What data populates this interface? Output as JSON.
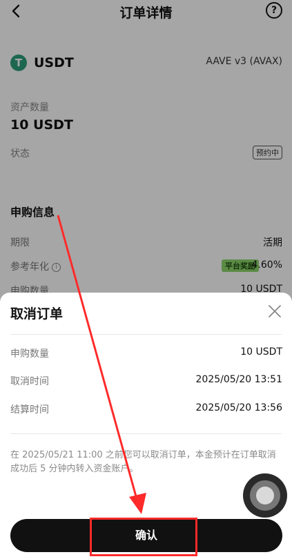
{
  "header": {
    "title": "订单详情",
    "back_icon": "chevron-left-icon",
    "help_icon": "help-circle-icon",
    "help_glyph": "?"
  },
  "asset": {
    "icon": "tether-icon",
    "icon_glyph": "T",
    "name": "USDT",
    "protocol": "AAVE v3 (AVAX)"
  },
  "summary": {
    "amount_label": "资产数量",
    "amount_value": "10 USDT",
    "status_label": "状态",
    "status_badge": "预约中"
  },
  "subscription": {
    "title": "申购信息",
    "term_label": "期限",
    "term_value": "活期",
    "apr_label": "参考年化",
    "reward_badge": "平台奖励",
    "apr_value": "4.60%",
    "subscribed_label": "申购数量",
    "subscribed_value": "10 USDT"
  },
  "sheet": {
    "title": "取消订单",
    "close_icon": "close-icon",
    "rows": [
      {
        "label": "申购数量",
        "value": "10 USDT"
      },
      {
        "label": "取消时间",
        "value": "2025/05/20 13:51"
      },
      {
        "label": "结算时间",
        "value": "2025/05/20 13:56"
      }
    ],
    "notice": "在 2025/05/21 11:00 之前您可以取消订单，本金预计在订单取消成功后 5 分钟内转入资金账户。",
    "confirm_label": "确认"
  },
  "colors": {
    "accent": "#111111",
    "tether_green": "#2d9f7b",
    "reward_green": "#8cd66a",
    "annotation_red": "#ff2a2a"
  }
}
